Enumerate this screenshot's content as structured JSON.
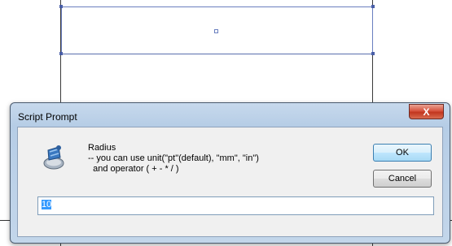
{
  "dialog": {
    "title": "Script Prompt",
    "close_label": "X",
    "icon": "script-app-icon",
    "message": {
      "heading": "Radius",
      "line1": "-- you can use unit(\"pt\"(default), \"mm\", \"in\")",
      "line2": "  and operator ( + - * / )"
    },
    "ok_label": "OK",
    "cancel_label": "Cancel",
    "input_value": "10"
  },
  "colors": {
    "titlebar": "#b6cde6",
    "close_button": "#c2361f",
    "selection": "#3399ff",
    "object_outline": "#6a7fbf"
  }
}
